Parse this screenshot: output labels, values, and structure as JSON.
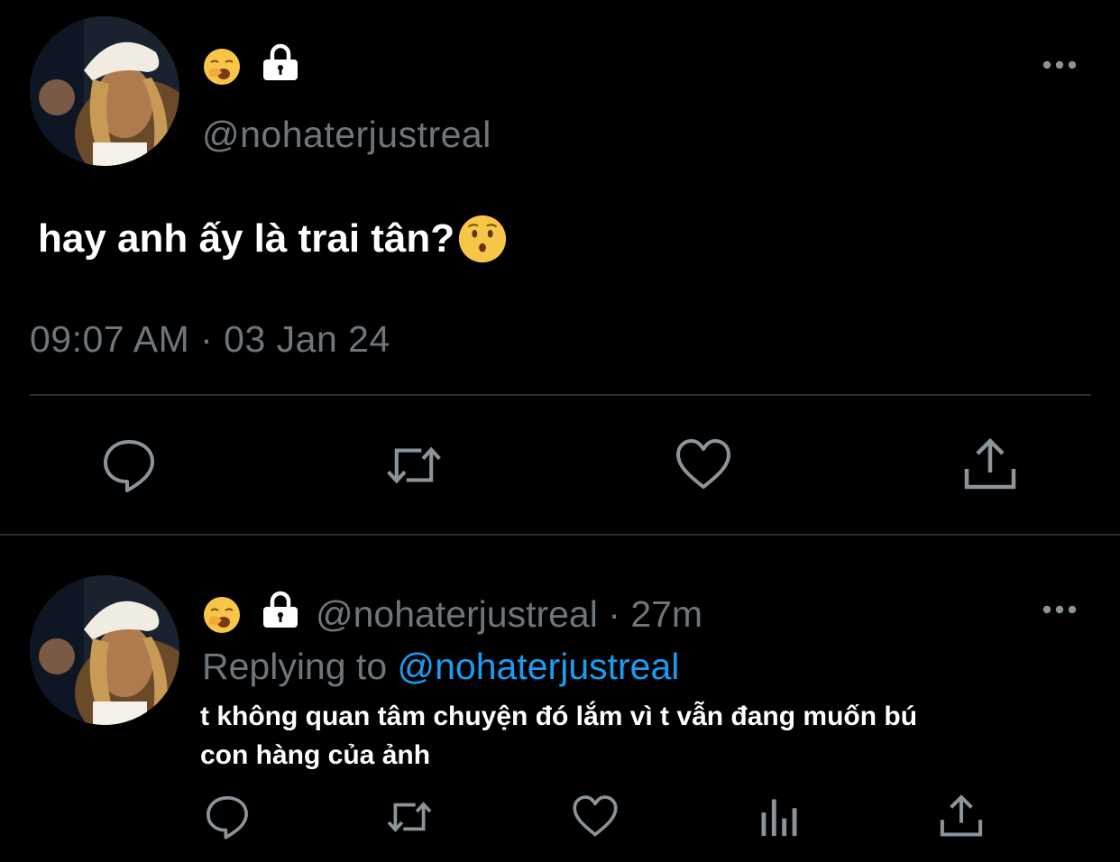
{
  "colors": {
    "background": "#000000",
    "muted": "#6e767d",
    "text": "#ffffff",
    "link": "#1d9bf0",
    "divider": "#2a2f33"
  },
  "main_tweet": {
    "avatar_icon": "profile-photo",
    "emoji_icon": "yawning-face-emoji",
    "lock_icon": "lock-icon",
    "handle": "@nohaterjustreal",
    "more_icon": "more-dots-icon",
    "text": "hay anh ấy là trai tân?",
    "text_emoji_icon": "hushed-face-emoji",
    "timestamp": "09:07 AM · 03 Jan 24",
    "actions": [
      "reply-icon",
      "retweet-icon",
      "like-icon",
      "share-icon"
    ]
  },
  "reply_tweet": {
    "avatar_icon": "profile-photo",
    "emoji_icon": "yawning-face-emoji",
    "lock_icon": "lock-icon",
    "handle": "@nohaterjustreal",
    "separator": "·",
    "time": "27m",
    "replying_prefix": "Replying to",
    "replying_handle": "@nohaterjustreal",
    "text_line1": "t không quan tâm chuyện đó lắm vì t vẫn đang muốn bú",
    "text_line2": "con hàng của ảnh",
    "actions": [
      "reply-icon",
      "retweet-icon",
      "like-icon",
      "analytics-icon",
      "share-icon"
    ]
  }
}
